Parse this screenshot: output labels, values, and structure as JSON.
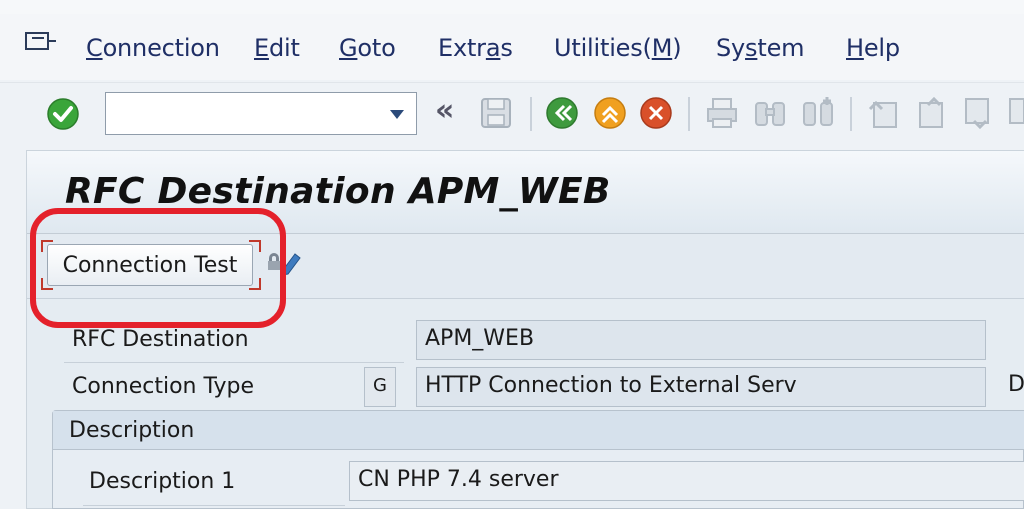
{
  "menu": {
    "items": [
      {
        "pre": "",
        "u": "C",
        "post": "onnection"
      },
      {
        "pre": "",
        "u": "E",
        "post": "dit"
      },
      {
        "pre": "",
        "u": "G",
        "post": "oto"
      },
      {
        "pre": "Extr",
        "u": "a",
        "post": "s"
      },
      {
        "pre": "Utilities(",
        "u": "M",
        "post": ")"
      },
      {
        "pre": "Sy",
        "u": "s",
        "post": "tem"
      },
      {
        "pre": "",
        "u": "H",
        "post": "elp"
      }
    ]
  },
  "toolbar": {
    "command_value": "",
    "back_glyph": "«"
  },
  "title": "RFC Destination APM_WEB",
  "app_toolbar": {
    "connection_test_label": "Connection Test"
  },
  "form": {
    "rfc_destination_label": "RFC Destination",
    "rfc_destination_value": "APM_WEB",
    "connection_type_label": "Connection Type",
    "connection_type_code": "G",
    "connection_type_value": "HTTP Connection to External Serv",
    "cut_text": "D"
  },
  "description_group": {
    "title": "Description",
    "description1_label": "Description 1",
    "description1_value": "CN PHP 7.4 server"
  },
  "colors": {
    "highlight_ring": "#e4212b",
    "ok_green": "#3aa53a",
    "back_green": "#3e9a3e",
    "exit_orange": "#f0a020",
    "cancel_red": "#d9502a"
  }
}
